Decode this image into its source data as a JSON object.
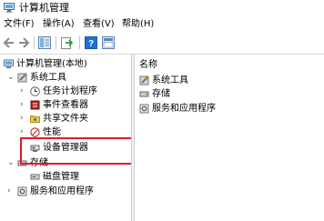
{
  "window": {
    "title": "计算机管理"
  },
  "menu": {
    "items": [
      "文件(F)",
      "操作(A)",
      "查看(V)",
      "帮助(H)"
    ]
  },
  "tree": {
    "root": "计算机管理(本地)",
    "system_tools": "系统工具",
    "task_scheduler": "任务计划程序",
    "event_viewer": "事件查看器",
    "shared_folders": "共享文件夹",
    "performance": "性能",
    "device_manager": "设备管理器",
    "storage": "存储",
    "disk_management": "磁盘管理",
    "services_apps": "服务和应用程序"
  },
  "right": {
    "header": "名称",
    "items": [
      "系统工具",
      "存储",
      "服务和应用程序"
    ]
  },
  "colors": {
    "highlight": "#e0192c",
    "accent": "#1f6fd6"
  },
  "icons": [
    "computer-management-icon",
    "back-arrow-icon",
    "forward-arrow-icon",
    "folder-view-icon",
    "export-icon",
    "help-icon",
    "properties-icon"
  ]
}
